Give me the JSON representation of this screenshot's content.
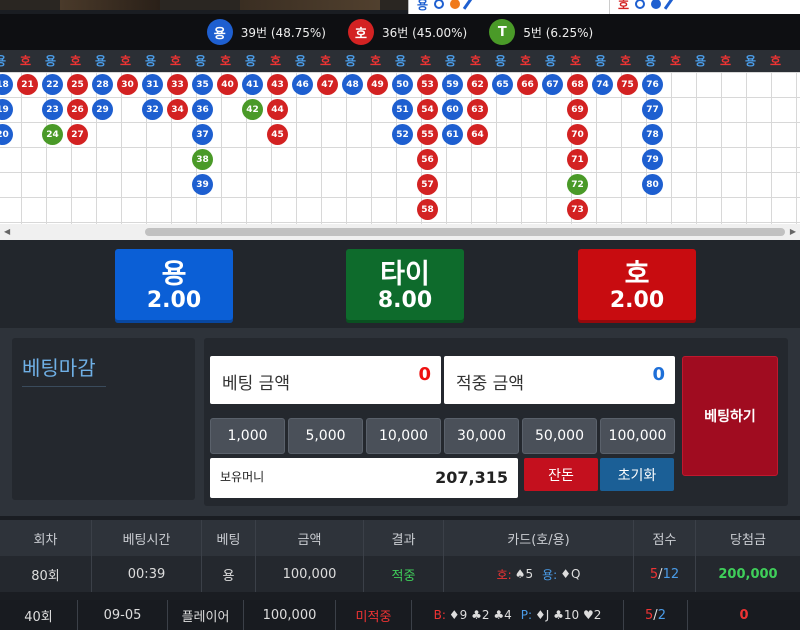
{
  "mini_road": {
    "left_label": "용",
    "right_label": "호"
  },
  "stats": [
    {
      "symbol": "용",
      "text": "39번 (48.75%)",
      "color": "#1e5fd0"
    },
    {
      "symbol": "호",
      "text": "36번 (45.00%)",
      "color": "#d32222"
    },
    {
      "symbol": "T",
      "text": "5번 (6.25%)",
      "color": "#3f9a2a"
    }
  ],
  "road_header": [
    "용",
    "호",
    "용",
    "호",
    "용",
    "호",
    "용",
    "호",
    "용",
    "호",
    "용",
    "호",
    "용",
    "호",
    "용",
    "호",
    "용",
    "호",
    "용",
    "호",
    "용",
    "호",
    "용",
    "호",
    "용",
    "호",
    "용",
    "호",
    "용",
    "호",
    "용",
    "호"
  ],
  "colors": {
    "dragon": "#1e5fd0",
    "tiger": "#d32222",
    "tie": "#4a9a28"
  },
  "bets": {
    "dragon": {
      "name": "용",
      "odds": "2.00"
    },
    "tie": {
      "name": "타이",
      "odds": "8.00"
    },
    "tiger": {
      "name": "호",
      "odds": "2.00"
    }
  },
  "panel": {
    "status": "베팅마감",
    "bet_amount_label": "베팅 금액",
    "bet_amount": "0",
    "win_amount_label": "적중 금액",
    "win_amount": "0",
    "chips": [
      "1,000",
      "5,000",
      "10,000",
      "30,000",
      "50,000",
      "100,000"
    ],
    "balance_label": "보유머니",
    "balance": "207,315",
    "change_button": "잔돈",
    "reset_button": "초기화",
    "place_bet_button": "베팅하기"
  },
  "table": {
    "headers": [
      "회차",
      "베팅시간",
      "베팅",
      "금액",
      "결과",
      "카드(호/용)",
      "점수",
      "당첨금"
    ],
    "row1": {
      "round": "80회",
      "time": "00:39",
      "bet": "용",
      "amount": "100,000",
      "result": "적중",
      "cards_a_label": "호:",
      "cards_a": "♠5",
      "cards_b_label": "용:",
      "cards_b": "♦Q",
      "score_a": "5",
      "score_sep": "/",
      "score_b": "12",
      "payout": "200,000"
    },
    "row2": {
      "round": "40회",
      "time": "09-05",
      "bet": "플레이어",
      "amount": "100,000",
      "result": "미적중",
      "cards_a_label": "B:",
      "cards_a": "♦9 ♣2 ♣4",
      "cards_b_label": "P:",
      "cards_b": "♦J ♣10 ♥2",
      "score_a": "5",
      "score_sep": "/",
      "score_b": "2",
      "payout": "0"
    }
  },
  "beads": [
    {
      "c": 0,
      "r": 0,
      "n": "18",
      "t": "D"
    },
    {
      "c": 0,
      "r": 1,
      "n": "19",
      "t": "D"
    },
    {
      "c": 0,
      "r": 2,
      "n": "20",
      "t": "D"
    },
    {
      "c": 1,
      "r": 0,
      "n": "21",
      "t": "H"
    },
    {
      "c": 2,
      "r": 0,
      "n": "22",
      "t": "D"
    },
    {
      "c": 2,
      "r": 1,
      "n": "23",
      "t": "D"
    },
    {
      "c": 2,
      "r": 2,
      "n": "24",
      "t": "T"
    },
    {
      "c": 3,
      "r": 0,
      "n": "25",
      "t": "H"
    },
    {
      "c": 3,
      "r": 1,
      "n": "26",
      "t": "H"
    },
    {
      "c": 3,
      "r": 2,
      "n": "27",
      "t": "H"
    },
    {
      "c": 4,
      "r": 0,
      "n": "28",
      "t": "D"
    },
    {
      "c": 4,
      "r": 1,
      "n": "29",
      "t": "D"
    },
    {
      "c": 5,
      "r": 0,
      "n": "30",
      "t": "H"
    },
    {
      "c": 6,
      "r": 0,
      "n": "31",
      "t": "D"
    },
    {
      "c": 6,
      "r": 1,
      "n": "32",
      "t": "D"
    },
    {
      "c": 7,
      "r": 0,
      "n": "33",
      "t": "H"
    },
    {
      "c": 7,
      "r": 1,
      "n": "34",
      "t": "H"
    },
    {
      "c": 8,
      "r": 0,
      "n": "35",
      "t": "D"
    },
    {
      "c": 8,
      "r": 1,
      "n": "36",
      "t": "D"
    },
    {
      "c": 8,
      "r": 2,
      "n": "37",
      "t": "D"
    },
    {
      "c": 8,
      "r": 3,
      "n": "38",
      "t": "T"
    },
    {
      "c": 8,
      "r": 4,
      "n": "39",
      "t": "D"
    },
    {
      "c": 9,
      "r": 0,
      "n": "40",
      "t": "H"
    },
    {
      "c": 10,
      "r": 0,
      "n": "41",
      "t": "D"
    },
    {
      "c": 10,
      "r": 1,
      "n": "42",
      "t": "T"
    },
    {
      "c": 11,
      "r": 0,
      "n": "43",
      "t": "H"
    },
    {
      "c": 11,
      "r": 1,
      "n": "44",
      "t": "H"
    },
    {
      "c": 11,
      "r": 2,
      "n": "45",
      "t": "H"
    },
    {
      "c": 12,
      "r": 0,
      "n": "46",
      "t": "D"
    },
    {
      "c": 13,
      "r": 0,
      "n": "47",
      "t": "H"
    },
    {
      "c": 14,
      "r": 0,
      "n": "48",
      "t": "D"
    },
    {
      "c": 15,
      "r": 0,
      "n": "49",
      "t": "H"
    },
    {
      "c": 16,
      "r": 0,
      "n": "50",
      "t": "D"
    },
    {
      "c": 16,
      "r": 1,
      "n": "51",
      "t": "D"
    },
    {
      "c": 16,
      "r": 2,
      "n": "52",
      "t": "D"
    },
    {
      "c": 17,
      "r": 0,
      "n": "53",
      "t": "H"
    },
    {
      "c": 17,
      "r": 1,
      "n": "54",
      "t": "H"
    },
    {
      "c": 17,
      "r": 2,
      "n": "55",
      "t": "H"
    },
    {
      "c": 17,
      "r": 3,
      "n": "56",
      "t": "H"
    },
    {
      "c": 17,
      "r": 4,
      "n": "57",
      "t": "H"
    },
    {
      "c": 17,
      "r": 5,
      "n": "58",
      "t": "H"
    },
    {
      "c": 18,
      "r": 0,
      "n": "59",
      "t": "D"
    },
    {
      "c": 18,
      "r": 1,
      "n": "60",
      "t": "D"
    },
    {
      "c": 18,
      "r": 2,
      "n": "61",
      "t": "D"
    },
    {
      "c": 19,
      "r": 0,
      "n": "62",
      "t": "H"
    },
    {
      "c": 19,
      "r": 1,
      "n": "63",
      "t": "H"
    },
    {
      "c": 19,
      "r": 2,
      "n": "64",
      "t": "H"
    },
    {
      "c": 20,
      "r": 0,
      "n": "65",
      "t": "D"
    },
    {
      "c": 21,
      "r": 0,
      "n": "66",
      "t": "H"
    },
    {
      "c": 22,
      "r": 0,
      "n": "67",
      "t": "D"
    },
    {
      "c": 23,
      "r": 0,
      "n": "68",
      "t": "H"
    },
    {
      "c": 23,
      "r": 1,
      "n": "69",
      "t": "H"
    },
    {
      "c": 23,
      "r": 2,
      "n": "70",
      "t": "H"
    },
    {
      "c": 23,
      "r": 3,
      "n": "71",
      "t": "H"
    },
    {
      "c": 23,
      "r": 4,
      "n": "72",
      "t": "T"
    },
    {
      "c": 23,
      "r": 5,
      "n": "73",
      "t": "H"
    },
    {
      "c": 24,
      "r": 0,
      "n": "74",
      "t": "D"
    },
    {
      "c": 25,
      "r": 0,
      "n": "75",
      "t": "H"
    },
    {
      "c": 26,
      "r": 0,
      "n": "76",
      "t": "D"
    },
    {
      "c": 26,
      "r": 1,
      "n": "77",
      "t": "D"
    },
    {
      "c": 26,
      "r": 2,
      "n": "78",
      "t": "D"
    },
    {
      "c": 26,
      "r": 3,
      "n": "79",
      "t": "D"
    },
    {
      "c": 26,
      "r": 4,
      "n": "80",
      "t": "D"
    }
  ]
}
